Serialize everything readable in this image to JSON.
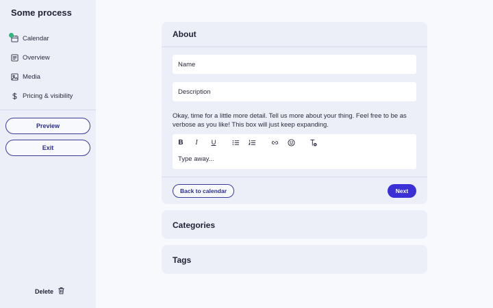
{
  "sidebar": {
    "title": "Some process",
    "items": [
      {
        "label": "Calendar",
        "icon": "calendar-icon",
        "status": "complete"
      },
      {
        "label": "Overview",
        "icon": "overview-icon"
      },
      {
        "label": "Media",
        "icon": "media-icon"
      },
      {
        "label": "Pricing & visibility",
        "icon": "dollar-icon"
      }
    ],
    "preview_label": "Preview",
    "exit_label": "Exit",
    "delete_label": "Delete",
    "delete_icon": "trash-icon"
  },
  "about": {
    "title": "About",
    "name_placeholder": "Name",
    "description_placeholder": "Description",
    "help_text": "Okay, time for a little more detail. Tell us more about your thing. Feel free to be as verbose as you like! This box will just keep expanding.",
    "editor": {
      "toolbar": [
        "bold-icon",
        "italic-icon",
        "underline-icon",
        "bullet-list-icon",
        "numbered-list-icon",
        "link-icon",
        "emoji-icon",
        "clear-format-icon"
      ],
      "placeholder": "Type away..."
    },
    "back_label": "Back to calendar",
    "next_label": "Next"
  },
  "categories": {
    "title": "Categories"
  },
  "tags": {
    "title": "Tags"
  },
  "colors": {
    "accent": "#3a30d6",
    "outline": "#3a3a9a",
    "success_dot": "#2fb67c",
    "panel": "#eceef8",
    "background": "#f8f9fd"
  }
}
